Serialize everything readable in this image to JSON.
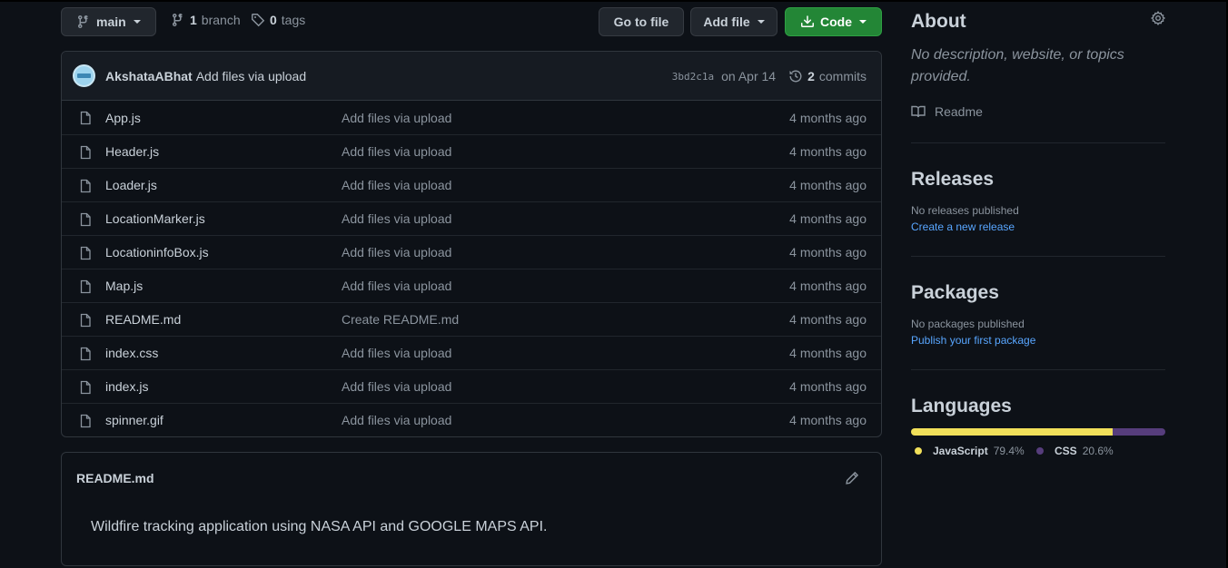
{
  "toolbar": {
    "branch_label": "main",
    "branches_count": "1",
    "branches_label": "branch",
    "tags_count": "0",
    "tags_label": "tags",
    "go_to_file": "Go to file",
    "add_file": "Add file",
    "code": "Code"
  },
  "commit": {
    "author": "AkshataABhat",
    "message": "Add files via upload",
    "sha": "3bd2c1a",
    "date": "on Apr 14",
    "commits_count": "2",
    "commits_label": "commits"
  },
  "files": [
    {
      "name": "App.js",
      "message": "Add files via upload",
      "age": "4 months ago"
    },
    {
      "name": "Header.js",
      "message": "Add files via upload",
      "age": "4 months ago"
    },
    {
      "name": "Loader.js",
      "message": "Add files via upload",
      "age": "4 months ago"
    },
    {
      "name": "LocationMarker.js",
      "message": "Add files via upload",
      "age": "4 months ago"
    },
    {
      "name": "LocationinfoBox.js",
      "message": "Add files via upload",
      "age": "4 months ago"
    },
    {
      "name": "Map.js",
      "message": "Add files via upload",
      "age": "4 months ago"
    },
    {
      "name": "README.md",
      "message": "Create README.md",
      "age": "4 months ago"
    },
    {
      "name": "index.css",
      "message": "Add files via upload",
      "age": "4 months ago"
    },
    {
      "name": "index.js",
      "message": "Add files via upload",
      "age": "4 months ago"
    },
    {
      "name": "spinner.gif",
      "message": "Add files via upload",
      "age": "4 months ago"
    }
  ],
  "readme": {
    "title": "README.md",
    "text": "Wildfire tracking application using NASA API and GOOGLE MAPS API."
  },
  "sidebar": {
    "about_title": "About",
    "about_desc": "No description, website, or topics provided.",
    "readme_link": "Readme",
    "releases_title": "Releases",
    "releases_text": "No releases published",
    "releases_link": "Create a new release",
    "packages_title": "Packages",
    "packages_text": "No packages published",
    "packages_link": "Publish your first package",
    "languages_title": "Languages",
    "languages": [
      {
        "name": "JavaScript",
        "percent": "79.4%",
        "value": 79.4,
        "color": "#f1e05a"
      },
      {
        "name": "CSS",
        "percent": "20.6%",
        "value": 20.6,
        "color": "#563d7c"
      }
    ]
  }
}
